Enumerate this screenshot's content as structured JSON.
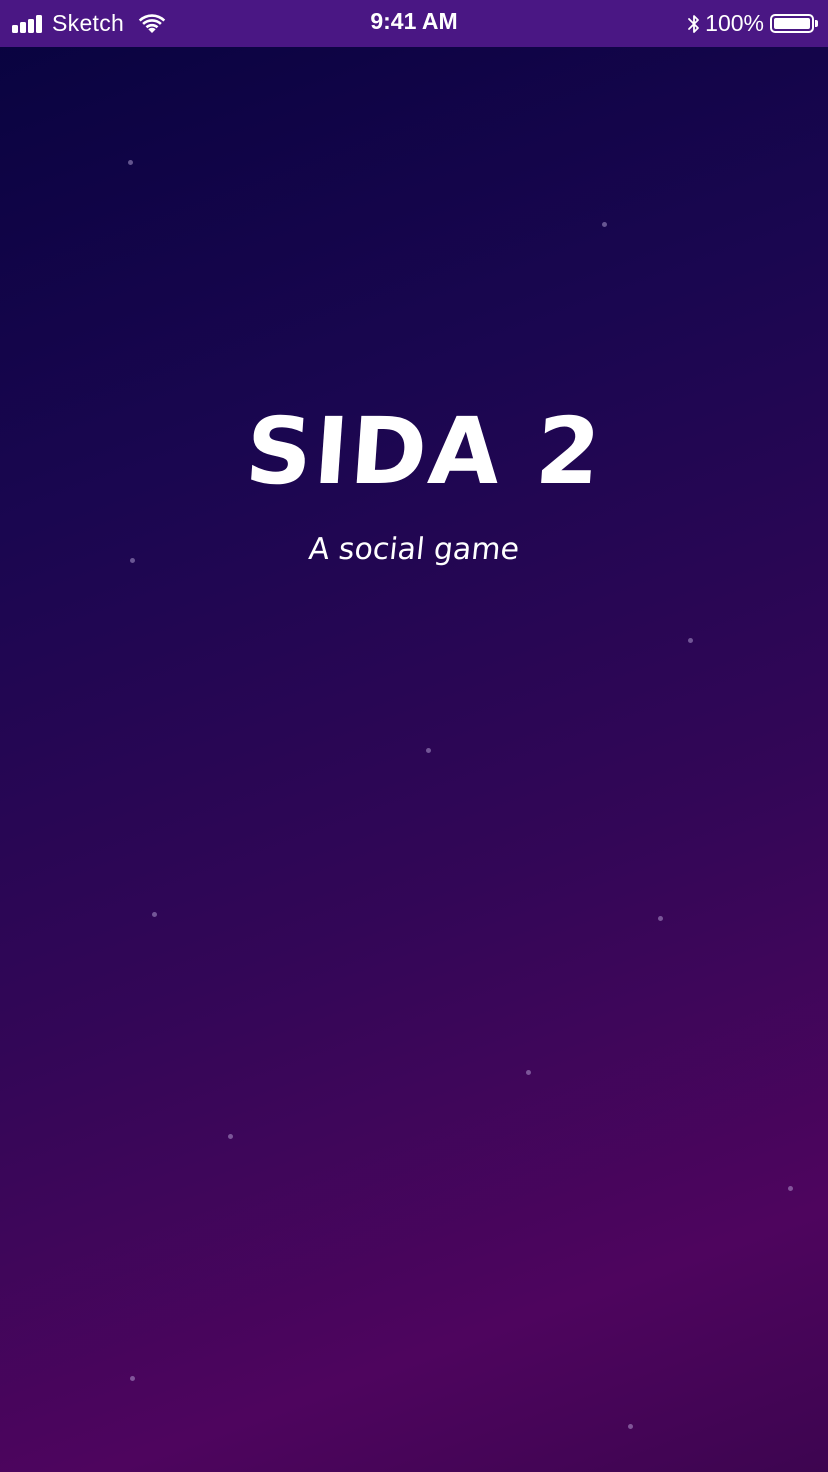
{
  "status_bar": {
    "carrier": "Sketch",
    "time": "9:41 AM",
    "battery_percent": "100%",
    "battery_level": 1.0,
    "icons": [
      "signal-icon",
      "wifi-icon",
      "bluetooth-icon",
      "battery-icon"
    ]
  },
  "splash": {
    "title": "SIDA 2",
    "subtitle": "A social game"
  },
  "colors": {
    "status_bar_bg": "#4a1784",
    "gradient_top": "#08033f",
    "gradient_bottom": "#4e055e",
    "text": "#ffffff"
  }
}
